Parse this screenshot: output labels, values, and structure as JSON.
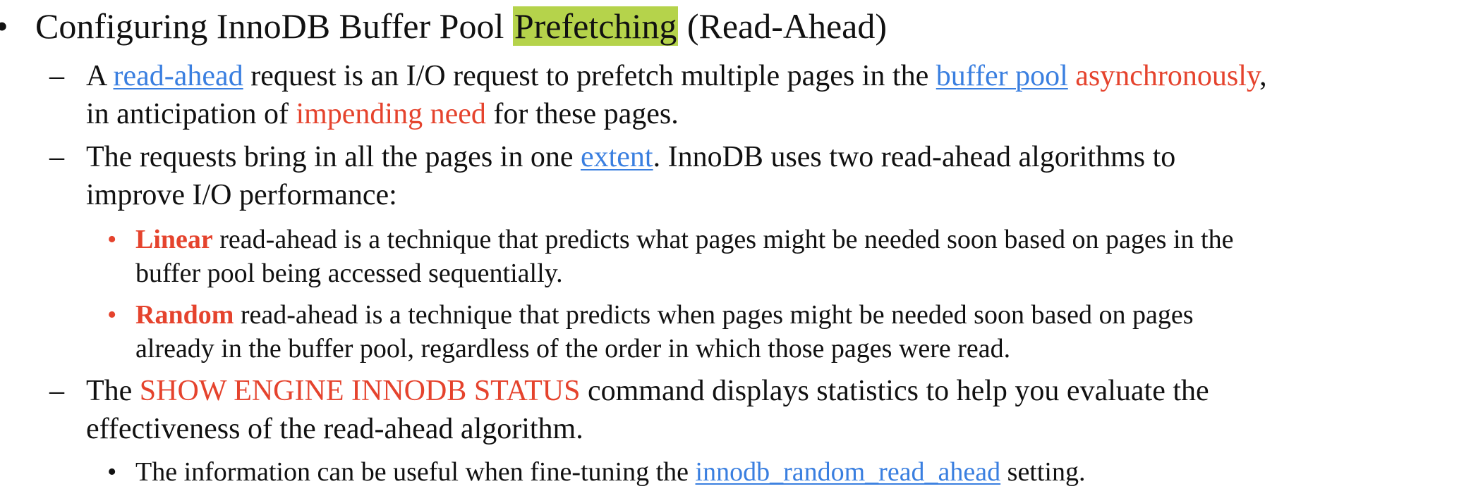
{
  "title": {
    "bullet": "•",
    "before": "Configuring InnoDB Buffer Pool ",
    "highlight": "Prefetching",
    "after": " (Read-Ahead)"
  },
  "item1": {
    "dash": "–",
    "t1": "A ",
    "link1": "read-ahead",
    "t2": " request is an I/O request to prefetch multiple pages in the ",
    "link2": "buffer pool",
    "t3": " ",
    "red1": "asynchronously",
    "t4": ",",
    "line2_a": "in anticipation of ",
    "red2": "impending need",
    "line2_b": " for these pages."
  },
  "item2": {
    "dash": "–",
    "t1": "The requests bring in all the pages in one ",
    "link": "extent",
    "t2": ". InnoDB uses two read-ahead algorithms to",
    "line2": "improve I/O performance:"
  },
  "sub1": {
    "bullet": "•",
    "bold": "Linear",
    "t1": " read-ahead is a technique that predicts what pages might be needed soon based on pages in the",
    "line2": "buffer pool being accessed sequentially."
  },
  "sub2": {
    "bullet": "•",
    "bold": "Random",
    "t1": " read-ahead is a technique that predicts when pages might be needed soon based on pages",
    "line2": "already in the buffer pool, regardless of the order in which those pages were read."
  },
  "item3": {
    "dash": "–",
    "t1": "The ",
    "red": "SHOW ENGINE INNODB STATUS",
    "t2": " command displays statistics to help you evaluate the",
    "line2": "effectiveness of the read-ahead algorithm."
  },
  "sub3": {
    "bullet": "•",
    "t1": "The information can be useful when fine-tuning the ",
    "link": "innodb_random_read_ahead",
    "t2": " setting."
  }
}
